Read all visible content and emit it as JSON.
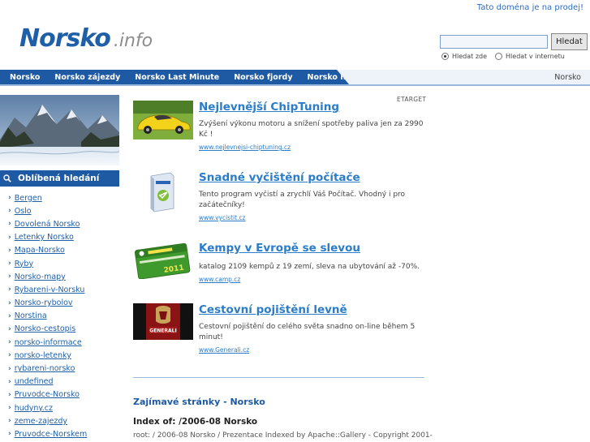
{
  "header": {
    "sale_notice": "Tato doména je na prodej!",
    "logo_main": "Norsko",
    "logo_suffix": ".info"
  },
  "search": {
    "value": "",
    "placeholder": "",
    "button_label": "Hledat",
    "options": [
      {
        "label": "Hledat zde",
        "checked": true
      },
      {
        "label": "Hledat v internetu",
        "checked": false
      }
    ]
  },
  "nav": {
    "tabs": [
      "Norsko",
      "Norsko zájezdy",
      "Norsko Last Minute",
      "Norsko fjordy",
      "Norsko na kole"
    ],
    "right_label": "Norsko"
  },
  "sidebar": {
    "header": "Oblíbená hledání",
    "items": [
      "Bergen",
      "Oslo",
      "Dovolená Norsko",
      "Letenky Norsko",
      "Mapa-Norsko",
      "Ryby",
      "Norsko-mapy",
      "Rybareni-v-Norsku",
      "Norsko-rybolov",
      "Norstina",
      "Norsko-cestopis",
      "norsko-informace",
      "norsko-letenky",
      "rybareni-norsko",
      "undefined",
      "Pruvodce-Norsko",
      "hudyny.cz",
      "zeme-zajezdy",
      "Pruvodce-Norskem"
    ]
  },
  "ads": {
    "provider_label": "ETARGET",
    "items": [
      {
        "title": "Nejlevnější ChipTuning",
        "description": "Zvýšení výkonu motoru a snížení spotřeby paliva jen za 2990 Kč !",
        "url": "www.nejlevnejsi-chiptuning.cz",
        "thumb_icon": "sports-car-image"
      },
      {
        "title": "Snadné vyčištění počítače",
        "description": "Tento program vyčistí a zrychlí Váš Počítač. Vhodný i pro začátečníky!",
        "url": "www.vycistit.cz",
        "thumb_icon": "software-box-image"
      },
      {
        "title": "Kempy v Evropě se slevou",
        "description": "katalog 2109 kempů z 19 zemí, sleva na ubytování až -70%.",
        "url": "www.camp.cz",
        "thumb_icon": "camping-card-image",
        "thumb_text": "2011"
      },
      {
        "title": "Cestovní pojištění levně",
        "description": "Cestovní pojištění do celého světa snadno on-line během 5 minut!",
        "url": "www.Generali.cz",
        "thumb_icon": "generali-logo-image",
        "thumb_text": "GENERALI"
      }
    ]
  },
  "content": {
    "section_title": "Zajímavé stránky - Norsko",
    "index_title": "Index of: /2006-08 Norsko",
    "breadcrumb": "root: / 2006-08 Norsko / Prezentace Indexed by Apache::Gallery - Copyright 2001-"
  },
  "colors": {
    "brand_blue": "#1e5aa3",
    "link_blue": "#2b7cc9",
    "nav_light": "#eef3f9"
  }
}
